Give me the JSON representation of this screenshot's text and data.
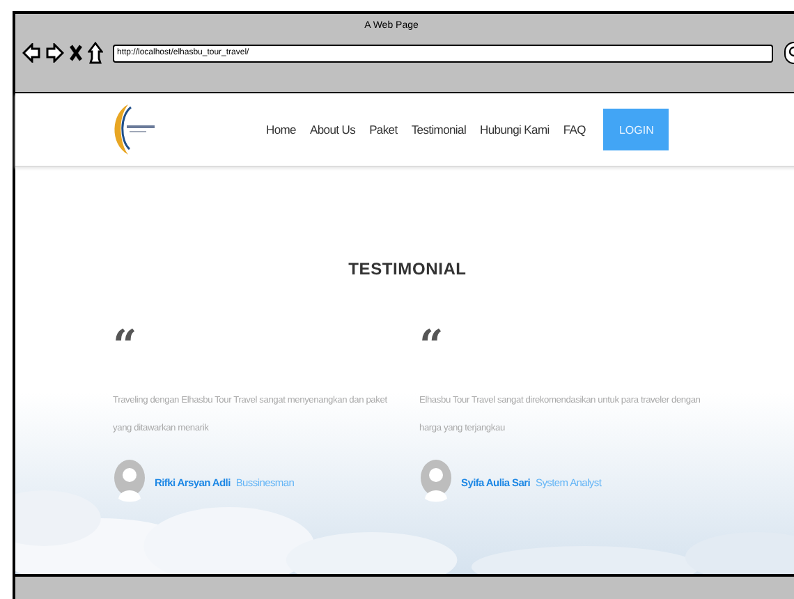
{
  "window": {
    "title": "A Web Page"
  },
  "address_bar": {
    "value": "http://localhost/elhasbu_tour_travel/"
  },
  "nav": {
    "items": [
      {
        "label": "Home"
      },
      {
        "label": "About Us"
      },
      {
        "label": "Paket"
      },
      {
        "label": "Testimonial"
      },
      {
        "label": "Hubungi Kami"
      },
      {
        "label": "FAQ"
      }
    ],
    "button": "LOGIN"
  },
  "section": {
    "title": "TESTIMONIAL"
  },
  "testimonials": [
    {
      "quote_mark": "“",
      "text": "Traveling dengan Elhasbu Tour Travel sangat menyenangkan dan paket yang ditawarkan menarik",
      "name": "Rifki Arsyan Adli",
      "role": "Bussinesman"
    },
    {
      "quote_mark": "“",
      "text": "Elhasbu Tour Travel sangat direkomendasikan untuk para traveler dengan harga yang terjangkau",
      "name": "Syifa Aulia Sari",
      "role": "System Analyst"
    }
  ]
}
